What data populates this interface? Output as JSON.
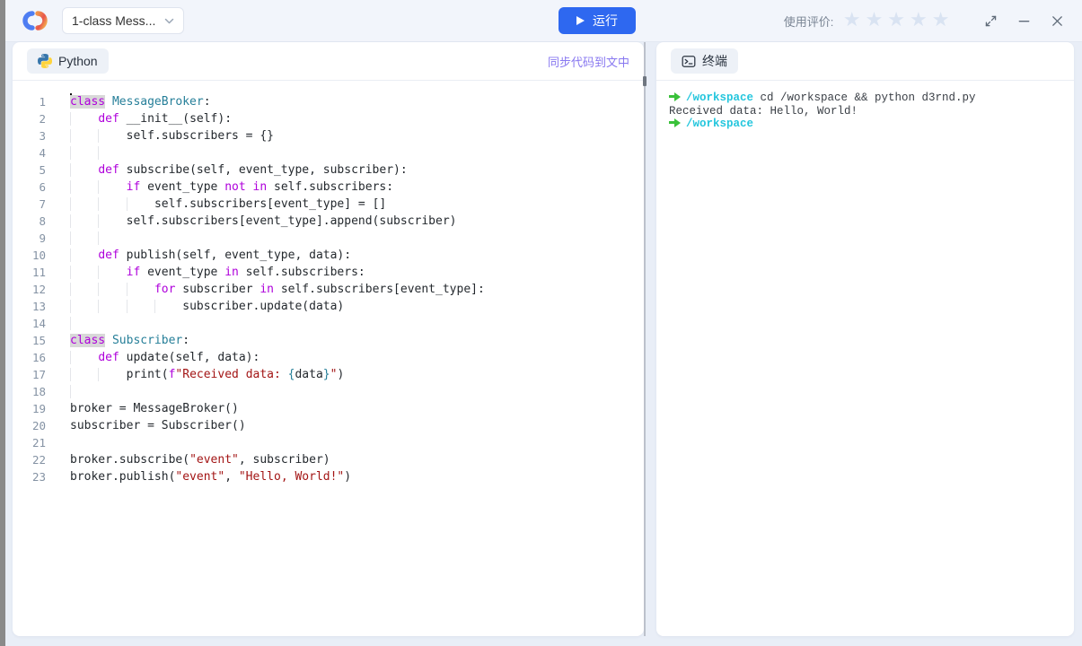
{
  "colors": {
    "accent_blue": "#2e68f0",
    "keyword_purple": "#af00db",
    "class_teal": "#267f99",
    "string_red": "#a31515",
    "code_default": "#24292e",
    "terminal_green": "#3ac13a",
    "terminal_cyan": "#24c6dd",
    "link_purple": "#8878f0",
    "star_gray": "#d9e3f2"
  },
  "topbar": {
    "logo_icon": "brand-swirl-icon",
    "file_selector": {
      "value": "1-class Mess...",
      "chevron_icon": "chevron-down-icon"
    },
    "run_button": {
      "label": "运行",
      "play_icon": "play-icon"
    },
    "rating": {
      "label": "使用评价:",
      "stars_total": 5,
      "stars_filled": 0,
      "star_icon": "star-icon"
    },
    "window_controls": [
      "expand-icon",
      "minimize-icon",
      "close-icon"
    ]
  },
  "editor": {
    "tab_label": "Python",
    "tab_icon": "python-icon",
    "sync_link": "同步代码到文中",
    "lines": [
      {
        "n": 1,
        "i": 0,
        "caret": true,
        "t": [
          [
            "khl",
            "class"
          ],
          [
            "d",
            " "
          ],
          [
            "c",
            "MessageBroker"
          ],
          [
            "d",
            ":"
          ]
        ]
      },
      {
        "n": 2,
        "i": 1,
        "t": [
          [
            "k",
            "def"
          ],
          [
            "d",
            " __init__(self):"
          ]
        ]
      },
      {
        "n": 3,
        "i": 2,
        "t": [
          [
            "d",
            "self.subscribers = {}"
          ]
        ]
      },
      {
        "n": 4,
        "i": 0,
        "g": 2,
        "t": []
      },
      {
        "n": 5,
        "i": 1,
        "t": [
          [
            "k",
            "def"
          ],
          [
            "d",
            " subscribe(self, event_type, subscriber):"
          ]
        ]
      },
      {
        "n": 6,
        "i": 2,
        "t": [
          [
            "k",
            "if"
          ],
          [
            "d",
            " event_type "
          ],
          [
            "k",
            "not"
          ],
          [
            "d",
            " "
          ],
          [
            "k",
            "in"
          ],
          [
            "d",
            " self.subscribers:"
          ]
        ]
      },
      {
        "n": 7,
        "i": 3,
        "t": [
          [
            "d",
            "self.subscribers[event_type] = []"
          ]
        ]
      },
      {
        "n": 8,
        "i": 2,
        "t": [
          [
            "d",
            "self.subscribers[event_type].append(subscriber)"
          ]
        ]
      },
      {
        "n": 9,
        "i": 0,
        "g": 2,
        "t": []
      },
      {
        "n": 10,
        "i": 1,
        "t": [
          [
            "k",
            "def"
          ],
          [
            "d",
            " publish(self, event_type, data):"
          ]
        ]
      },
      {
        "n": 11,
        "i": 2,
        "t": [
          [
            "k",
            "if"
          ],
          [
            "d",
            " event_type "
          ],
          [
            "k",
            "in"
          ],
          [
            "d",
            " self.subscribers:"
          ]
        ]
      },
      {
        "n": 12,
        "i": 3,
        "t": [
          [
            "k",
            "for"
          ],
          [
            "d",
            " subscriber "
          ],
          [
            "k",
            "in"
          ],
          [
            "d",
            " self.subscribers[event_type]:"
          ]
        ]
      },
      {
        "n": 13,
        "i": 4,
        "t": [
          [
            "d",
            "subscriber.update(data)"
          ]
        ]
      },
      {
        "n": 14,
        "i": 0,
        "g": 1,
        "t": []
      },
      {
        "n": 15,
        "i": 0,
        "t": [
          [
            "khl",
            "class"
          ],
          [
            "d",
            " "
          ],
          [
            "c",
            "Subscriber"
          ],
          [
            "d",
            ":"
          ]
        ]
      },
      {
        "n": 16,
        "i": 1,
        "t": [
          [
            "k",
            "def"
          ],
          [
            "d",
            " update(self, data):"
          ]
        ]
      },
      {
        "n": 17,
        "i": 2,
        "t": [
          [
            "d",
            "print("
          ],
          [
            "k",
            "f"
          ],
          [
            "s",
            "\"Received data: "
          ],
          [
            "b",
            "{"
          ],
          [
            "d",
            "data"
          ],
          [
            "b",
            "}"
          ],
          [
            "s",
            "\""
          ],
          [
            "d",
            ")"
          ]
        ]
      },
      {
        "n": 18,
        "i": 0,
        "g": 1,
        "t": []
      },
      {
        "n": 19,
        "i": 0,
        "t": [
          [
            "d",
            "broker = MessageBroker()"
          ]
        ]
      },
      {
        "n": 20,
        "i": 0,
        "t": [
          [
            "d",
            "subscriber = Subscriber()"
          ]
        ]
      },
      {
        "n": 21,
        "i": 0,
        "g": 0,
        "t": []
      },
      {
        "n": 22,
        "i": 0,
        "t": [
          [
            "d",
            "broker.subscribe("
          ],
          [
            "s",
            "\"event\""
          ],
          [
            "d",
            ", subscriber)"
          ]
        ]
      },
      {
        "n": 23,
        "i": 0,
        "t": [
          [
            "d",
            "broker.publish("
          ],
          [
            "s",
            "\"event\""
          ],
          [
            "d",
            ", "
          ],
          [
            "s",
            "\"Hello, World!\""
          ],
          [
            "d",
            ")"
          ]
        ]
      }
    ]
  },
  "terminal": {
    "tab_label": "终端",
    "tab_icon": "terminal-icon",
    "prompt_icon": "arrow-right-prompt-icon",
    "lines": [
      {
        "type": "cmd",
        "path": "/workspace",
        "text": "cd /workspace && python d3rnd.py"
      },
      {
        "type": "out",
        "text": "Received data: Hello, World!"
      },
      {
        "type": "cmd",
        "path": "/workspace",
        "text": ""
      }
    ]
  }
}
